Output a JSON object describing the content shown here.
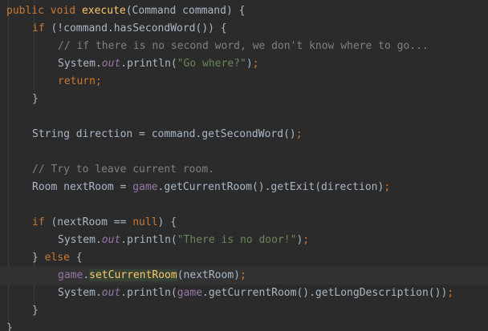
{
  "editor": {
    "lines": [
      [
        "public",
        " ",
        "void",
        " ",
        "execute",
        "(Command command) {"
      ],
      [
        "if",
        " (!command.hasSecondWord()) {"
      ],
      [
        "// if there is no second word, we don't know where to go..."
      ],
      [
        "System.",
        "out",
        ".println(",
        "\"Go where?\"",
        ")",
        ";"
      ],
      [
        "return",
        ";"
      ],
      [
        "}"
      ],
      [
        ""
      ],
      [
        "String direction = command.getSecondWord()",
        ";"
      ],
      [
        ""
      ],
      [
        "// Try to leave current room."
      ],
      [
        "Room nextRoom = ",
        "game",
        ".getCurrentRoom().getExit(direction)",
        ";"
      ],
      [
        ""
      ],
      [
        "if",
        " (nextRoom == ",
        "null",
        ") {"
      ],
      [
        "System.",
        "out",
        ".println(",
        "\"There is no door!\"",
        ")",
        ";"
      ],
      [
        "} ",
        "else",
        " {"
      ],
      [
        "game",
        ".",
        "setCurrentRoom",
        "(nextRoom)",
        ";"
      ],
      [
        "System.",
        "out",
        ".println(",
        "game",
        ".getCurrentRoom().getLongDescription())",
        ";"
      ],
      [
        "}"
      ],
      [
        "}"
      ]
    ],
    "colors": {
      "background": "#2b2b2b",
      "keyword": "#cc7832",
      "method": "#ffc66d",
      "field": "#9876aa",
      "string": "#6a8759",
      "comment": "#808080",
      "plain": "#a9b7c6",
      "current_line": "#323232"
    }
  }
}
